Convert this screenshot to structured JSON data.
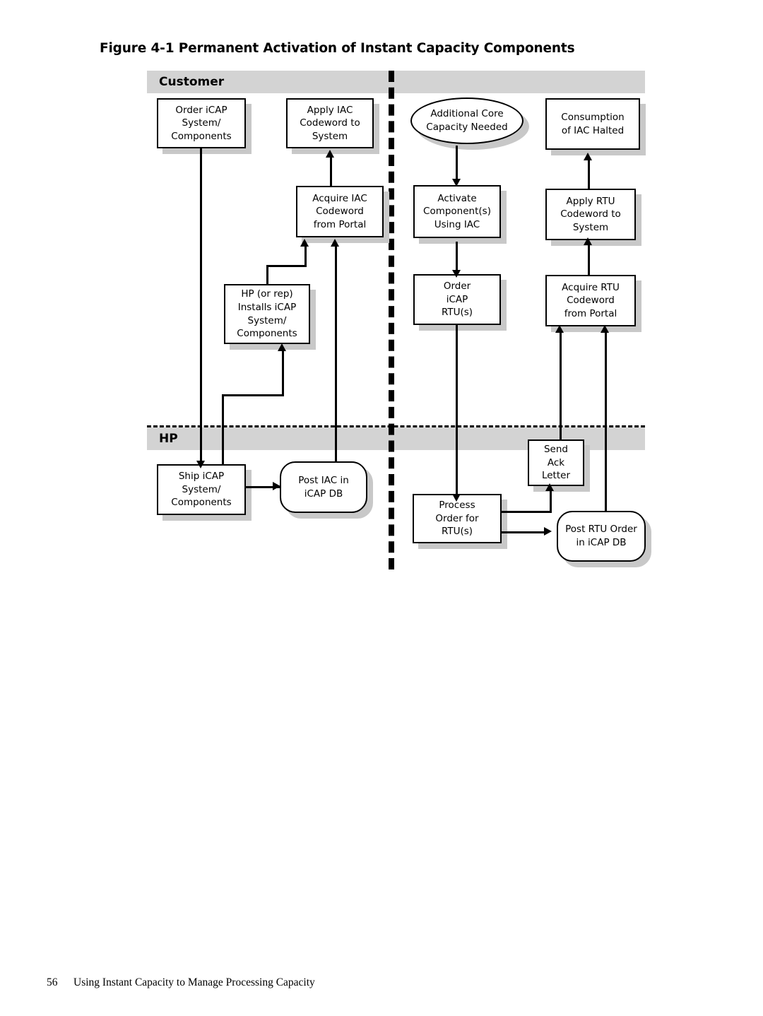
{
  "document": {
    "figure_label": "Figure 4-1",
    "figure_title": "Permanent Activation of Instant Capacity Components",
    "figure_caption_full": "Figure 4-1 Permanent Activation of Instant Capacity Components",
    "footer": {
      "page_number": "56",
      "running_head": "Using Instant Capacity to Manage Processing Capacity"
    }
  },
  "diagram": {
    "type": "swimlane-flowchart",
    "colors": {
      "lane_band": "#d3d3d3",
      "node_fill": "#ffffff",
      "node_stroke": "#000000",
      "shadow": "#c8c8c8"
    },
    "lanes": [
      {
        "id": "customer",
        "label": "Customer"
      },
      {
        "id": "hp",
        "label": "HP"
      }
    ],
    "columns": [
      {
        "id": "initial-purchase",
        "label": ""
      },
      {
        "id": "activation",
        "label": ""
      }
    ],
    "nodes": [
      {
        "id": "order-icap",
        "lane": "customer",
        "shape": "rect",
        "text": "Order iCAP\nSystem/\nComponents"
      },
      {
        "id": "apply-iac",
        "lane": "customer",
        "shape": "rect",
        "text": "Apply IAC\nCodeword to\nSystem"
      },
      {
        "id": "acquire-iac",
        "lane": "customer",
        "shape": "rect",
        "text": "Acquire IAC\nCodeword\nfrom Portal"
      },
      {
        "id": "hp-installs",
        "lane": "customer",
        "shape": "rect",
        "text": "HP (or rep)\nInstalls iCAP\nSystem/\nComponents"
      },
      {
        "id": "additional-core",
        "lane": "customer",
        "shape": "oval",
        "text": "Additional Core\nCapacity Needed"
      },
      {
        "id": "activate-components",
        "lane": "customer",
        "shape": "rect",
        "text": "Activate\nComponent(s)\nUsing IAC"
      },
      {
        "id": "order-icap-rtus",
        "lane": "customer",
        "shape": "rect",
        "text": "Order\niCAP\nRTU(s)"
      },
      {
        "id": "consumption-halted",
        "lane": "customer",
        "shape": "rect",
        "text": "Consumption\nof IAC Halted"
      },
      {
        "id": "apply-rtu",
        "lane": "customer",
        "shape": "rect",
        "text": "Apply RTU\nCodeword to\nSystem"
      },
      {
        "id": "acquire-rtu",
        "lane": "customer",
        "shape": "rect",
        "text": "Acquire RTU\nCodeword\nfrom Portal"
      },
      {
        "id": "ship-icap",
        "lane": "hp",
        "shape": "rect",
        "text": "Ship iCAP\nSystem/\nComponents"
      },
      {
        "id": "post-iac-db",
        "lane": "hp",
        "shape": "rounded",
        "text": "Post IAC in\niCAP DB"
      },
      {
        "id": "send-ack",
        "lane": "hp",
        "shape": "rect",
        "text": "Send\nAck\nLetter"
      },
      {
        "id": "process-order-rtus",
        "lane": "hp",
        "shape": "rect",
        "text": "Process\nOrder for\nRTU(s)"
      },
      {
        "id": "post-rtu-db",
        "lane": "hp",
        "shape": "rounded",
        "text": "Post RTU Order\nin iCAP DB"
      }
    ],
    "edges": [
      {
        "from": "order-icap",
        "to": "ship-icap"
      },
      {
        "from": "ship-icap",
        "to": "hp-installs"
      },
      {
        "from": "ship-icap",
        "to": "post-iac-db"
      },
      {
        "from": "hp-installs",
        "to": "acquire-iac"
      },
      {
        "from": "post-iac-db",
        "to": "acquire-iac"
      },
      {
        "from": "acquire-iac",
        "to": "apply-iac"
      },
      {
        "from": "additional-core",
        "to": "activate-components"
      },
      {
        "from": "activate-components",
        "to": "order-icap-rtus"
      },
      {
        "from": "order-icap-rtus",
        "to": "process-order-rtus"
      },
      {
        "from": "process-order-rtus",
        "to": "send-ack"
      },
      {
        "from": "process-order-rtus",
        "to": "post-rtu-db"
      },
      {
        "from": "send-ack",
        "to": "acquire-rtu"
      },
      {
        "from": "post-rtu-db",
        "to": "acquire-rtu"
      },
      {
        "from": "acquire-rtu",
        "to": "apply-rtu"
      },
      {
        "from": "apply-rtu",
        "to": "consumption-halted"
      }
    ]
  }
}
